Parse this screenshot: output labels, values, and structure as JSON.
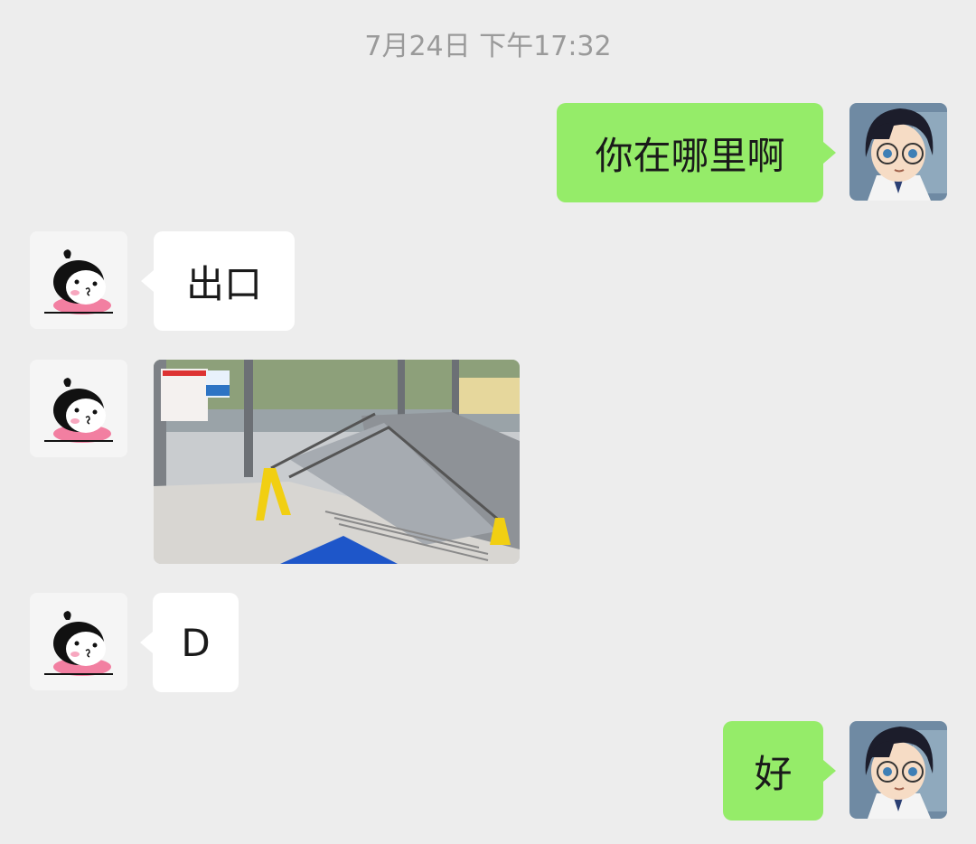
{
  "chat": {
    "timestamp": "7月24日 下午17:32",
    "messages": [
      {
        "sender": "me",
        "type": "text",
        "text": "你在哪里啊"
      },
      {
        "sender": "other",
        "type": "text",
        "text": "出口"
      },
      {
        "sender": "other",
        "type": "image",
        "image_description": "subway exit escalator with yellow caution signs"
      },
      {
        "sender": "other",
        "type": "text",
        "text": "D"
      },
      {
        "sender": "me",
        "type": "text",
        "text": "好"
      }
    ]
  },
  "colors": {
    "background": "#ededed",
    "outgoing_bubble": "#95ec69",
    "incoming_bubble": "#ffffff",
    "timestamp_text": "#9a9a9a"
  },
  "icons": {
    "me_avatar": "anime-boy-glasses-avatar-icon",
    "other_avatar": "cartoon-girl-avatar-icon"
  }
}
